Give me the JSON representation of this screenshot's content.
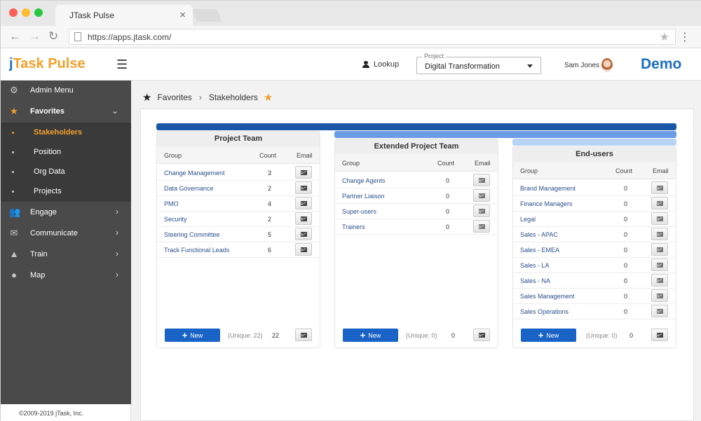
{
  "browser": {
    "tab_title": "JTask Pulse",
    "tab_close": "×",
    "url": "https://apps.jtask.com/"
  },
  "header": {
    "logo_j": "j",
    "logo_rest": "Task Pulse",
    "lookup_label": "Lookup",
    "project_legend": "Project",
    "project_value": "Digital Transformation",
    "user_name": "Sam Jones",
    "demo_label": "Demo"
  },
  "sidebar": {
    "items": [
      {
        "label": "Admin Menu",
        "icon": "gear-icon"
      },
      {
        "label": "Favorites",
        "icon": "star-icon"
      },
      {
        "label": "Stakeholders"
      },
      {
        "label": "Position"
      },
      {
        "label": "Org Data"
      },
      {
        "label": "Projects"
      },
      {
        "label": "Engage",
        "icon": "people-icon"
      },
      {
        "label": "Communicate",
        "icon": "chat-icon"
      },
      {
        "label": "Train",
        "icon": "graduation-cap-icon"
      },
      {
        "label": "Map",
        "icon": "map-pin-icon"
      }
    ],
    "footer": "©2009-2019 jTask, Inc."
  },
  "breadcrumb": {
    "root": "Favorites",
    "current": "Stakeholders"
  },
  "columns": {
    "group": "Group",
    "count": "Count",
    "email": "Email"
  },
  "new_label": "New",
  "bar_colors": [
    "#1a56a8",
    "#6b9ce6",
    "#b9d3f5"
  ],
  "panels": [
    {
      "title": "Project Team",
      "rows": [
        {
          "group": "Change Management",
          "count": "3"
        },
        {
          "group": "Data Governance",
          "count": "2"
        },
        {
          "group": "PMO",
          "count": "4"
        },
        {
          "group": "Security",
          "count": "2"
        },
        {
          "group": "Steering Committee",
          "count": "5"
        },
        {
          "group": "Track Functional Leads",
          "count": "6"
        }
      ],
      "unique": "(Unique: 22)",
      "total": "22"
    },
    {
      "title": "Extended Project Team",
      "rows": [
        {
          "group": "Change Agents",
          "count": "0"
        },
        {
          "group": "Partner Liaison",
          "count": "0"
        },
        {
          "group": "Super-users",
          "count": "0"
        },
        {
          "group": "Trainers",
          "count": "0"
        }
      ],
      "unique": "(Unique: 0)",
      "total": "0"
    },
    {
      "title": "End-users",
      "rows": [
        {
          "group": "Brand Management",
          "count": "0"
        },
        {
          "group": "Finance Managers",
          "count": "0"
        },
        {
          "group": "Legal",
          "count": "0"
        },
        {
          "group": "Sales - APAC",
          "count": "0"
        },
        {
          "group": "Sales - EMEA",
          "count": "0"
        },
        {
          "group": "Sales - LA",
          "count": "0"
        },
        {
          "group": "Sales - NA",
          "count": "0"
        },
        {
          "group": "Sales Management",
          "count": "0"
        },
        {
          "group": "Sales Operations",
          "count": "0"
        }
      ],
      "unique": "(Unique: 0)",
      "total": "0"
    }
  ]
}
